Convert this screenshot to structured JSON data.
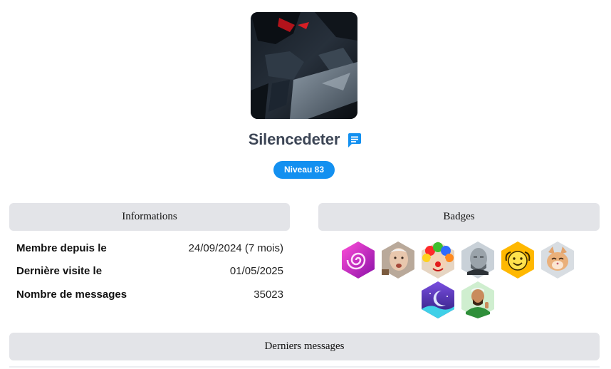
{
  "profile": {
    "username": "Silencedeter",
    "level": "Niveau 83",
    "avatar_icon": "dark-robot-avatar",
    "message_icon": "chat-bubble-icon",
    "accent_color": "#1390f0"
  },
  "sections": {
    "informations": "Informations",
    "badges": "Badges",
    "derniers_messages": "Derniers messages"
  },
  "info": [
    {
      "label": "Membre depuis le",
      "value": "24/09/2024 (7 mois)"
    },
    {
      "label": "Dernière visite le",
      "value": "01/05/2025"
    },
    {
      "label": "Nombre de messages",
      "value": "35023"
    }
  ],
  "badges": [
    {
      "icon": "pink-spiral-badge-icon"
    },
    {
      "icon": "elderly-man-meme-badge-icon"
    },
    {
      "icon": "clown-badge-icon"
    },
    {
      "icon": "bald-man-badge-icon"
    },
    {
      "icon": "yellow-smiley-badge-icon"
    },
    {
      "icon": "cat-badge-icon"
    },
    {
      "icon": "moon-night-badge-icon"
    },
    {
      "icon": "thumbs-up-man-badge-icon"
    }
  ]
}
